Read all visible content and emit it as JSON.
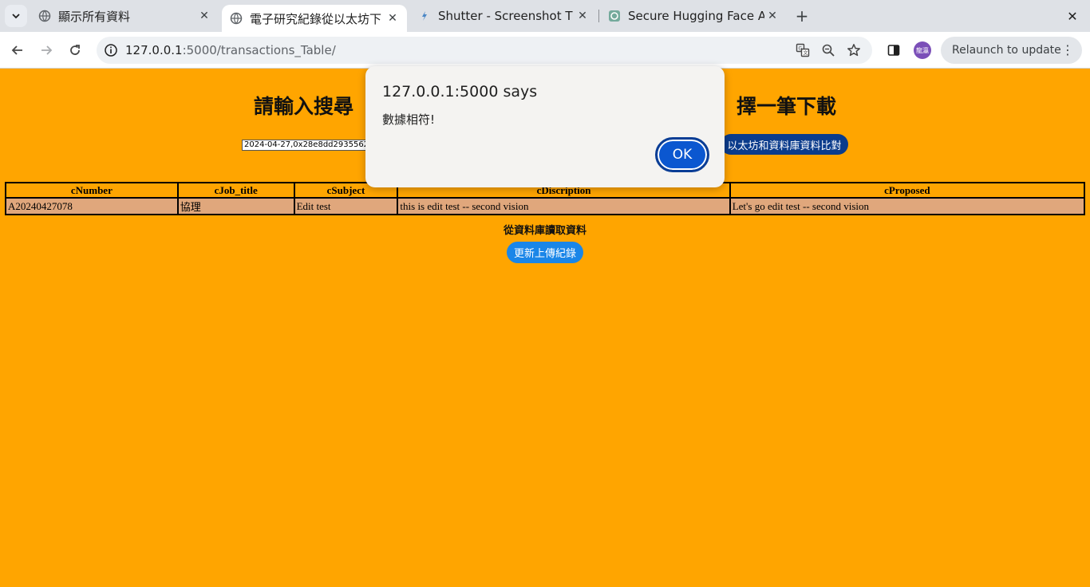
{
  "browser": {
    "tabs": [
      {
        "title": "顯示所有資料",
        "active": false
      },
      {
        "title": "電子研究紀錄從以太坊下",
        "active": true
      },
      {
        "title": "Shutter - Screenshot T",
        "active": false
      },
      {
        "title": "Secure Hugging Face A",
        "active": false
      }
    ],
    "url_host": "127.0.0.1",
    "url_path": ":5000/transactions_Table/",
    "profile_badge": "龍瀛",
    "relaunch_label": "Relaunch to update"
  },
  "page": {
    "heading_left": "請輸入搜尋",
    "heading_right": "擇一筆下載",
    "search_value": "2024-04-27,0x28e8dd29355626",
    "compare_button": "以太坊和資料庫資料比對",
    "table": {
      "columns": [
        "cNumber",
        "cJob_title",
        "cSubject",
        "cDiscription",
        "cProposed"
      ],
      "rows": [
        [
          "A20240427078",
          "協理",
          "Edit test",
          "this is edit test -- second vision",
          "Let's go edit test -- second vision"
        ]
      ]
    },
    "db_label": "從資料庫讀取資料",
    "refresh_button": "更新上傳紀錄"
  },
  "dialog": {
    "title": "127.0.0.1:5000 says",
    "message": "數據相符!",
    "ok_label": "OK"
  }
}
